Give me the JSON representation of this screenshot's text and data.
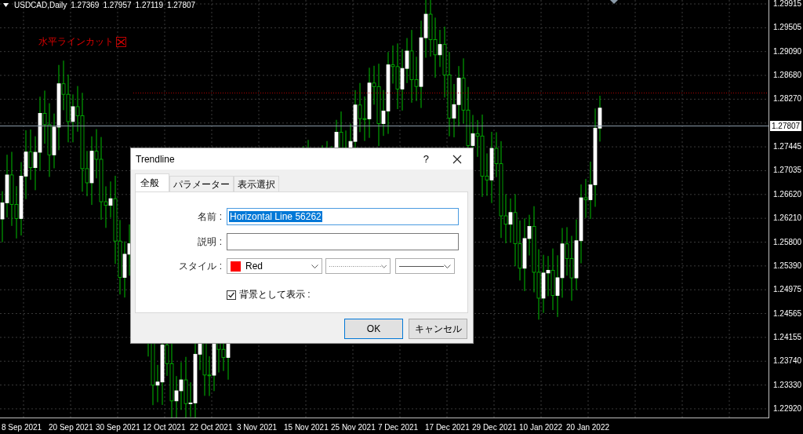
{
  "chart": {
    "symbol": "USDCAD,Daily",
    "ohlc": [
      "1.27369",
      "1.27957",
      "1.27119",
      "1.27807"
    ],
    "object_label": "水平ラインカット",
    "price_labels": [
      "1.29915",
      "1.29505",
      "1.29090",
      "1.28680",
      "1.28270",
      "1.27445",
      "1.27035",
      "1.26620",
      "1.26210",
      "1.25800",
      "1.25390",
      "1.24975",
      "1.24565",
      "1.24155",
      "1.23740",
      "1.23330",
      "1.22920"
    ],
    "current_price": "1.27807",
    "date_labels": [
      "8 Sep 2021",
      "20 Sep 2021",
      "30 Sep 2021",
      "12 Oct 2021",
      "22 Oct 2021",
      "3 Nov 2021",
      "15 Nov 2021",
      "25 Nov 2021",
      "7 Dec 2021",
      "17 Dec 2021",
      "29 Dec 2021",
      "10 Jan 2022",
      "20 Jan 2022"
    ]
  },
  "dialog": {
    "title": "Trendline",
    "help": "?",
    "tabs": [
      {
        "label": "全般",
        "selected": true
      },
      {
        "label": "パラメーター",
        "selected": false
      },
      {
        "label": "表示選択",
        "selected": false
      }
    ],
    "name_field": {
      "label": "名前 :",
      "value": "Horizontal Line 56262",
      "text_selected": true
    },
    "description_field": {
      "label": "説明 :"
    },
    "style": {
      "label": "スタイル :",
      "color_name": "Red",
      "color": "#ff0000"
    },
    "background_checkbox": {
      "label": "背景として表示 :",
      "checked": true
    },
    "buttons": [
      {
        "label": "OK",
        "default": true
      },
      {
        "label": "キャンセル",
        "default": false
      }
    ]
  }
}
